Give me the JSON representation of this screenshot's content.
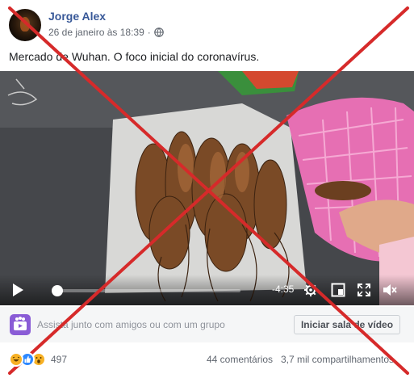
{
  "post": {
    "author": "Jorge Alex",
    "date": "26 de janeiro às 18:39",
    "privacy_icon": "globe-icon",
    "caption": "Mercado de Wuhan. O foco inicial do coronavírus."
  },
  "video": {
    "time_remaining": "-4:35",
    "progress": 0.0,
    "icons": [
      "play-icon",
      "settings-icon",
      "fullscreen-minimize-icon",
      "expand-icon",
      "volume-icon"
    ]
  },
  "watch_party": {
    "text": "Assista junto com amigos ou com um grupo",
    "button_label": "Iniciar sala de vídeo"
  },
  "reactions": {
    "count": "497",
    "types": [
      "haha",
      "like",
      "wow"
    ],
    "comments": "44 comentários",
    "shares": "3,7 mil compartilhamentos"
  },
  "colors": {
    "author_link": "#385898",
    "overlay_x": "#d62a2a"
  }
}
